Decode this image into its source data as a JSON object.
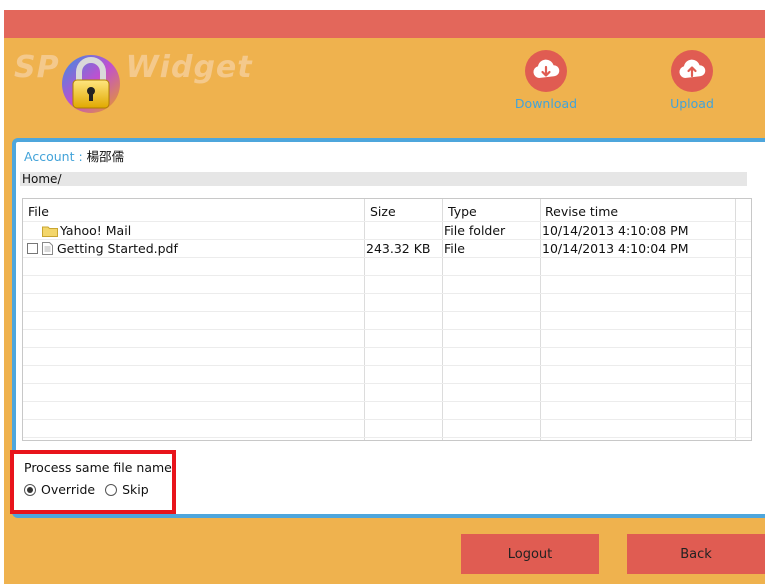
{
  "header": {
    "logo_left": "SP",
    "logo_right": "Widget",
    "download_label": "Download",
    "upload_label": "Upload"
  },
  "account": {
    "label": "Account :",
    "name": "楊邵儒"
  },
  "path": "Home/",
  "table": {
    "columns": [
      "File",
      "Size",
      "Type",
      "Revise time"
    ],
    "rows": [
      {
        "icon": "folder-icon",
        "name": "Yahoo! Mail",
        "size": "",
        "type": "File folder",
        "time": "10/14/2013 4:10:08 PM"
      },
      {
        "icon": "document-icon",
        "name": "Getting Started.pdf",
        "size": "243.32 KB",
        "type": "File",
        "time": "10/14/2013 4:10:04 PM"
      }
    ]
  },
  "options": {
    "title": "Process same file name",
    "override_label": "Override",
    "skip_label": "Skip",
    "selected": "override"
  },
  "footer": {
    "logout_label": "Logout",
    "back_label": "Back"
  },
  "colors": {
    "top_bar": "#e3675b",
    "header_bg": "#efb24e",
    "accent_blue": "#4ea6dc",
    "button_red": "#e05c52",
    "highlight_red": "#e8141b"
  }
}
